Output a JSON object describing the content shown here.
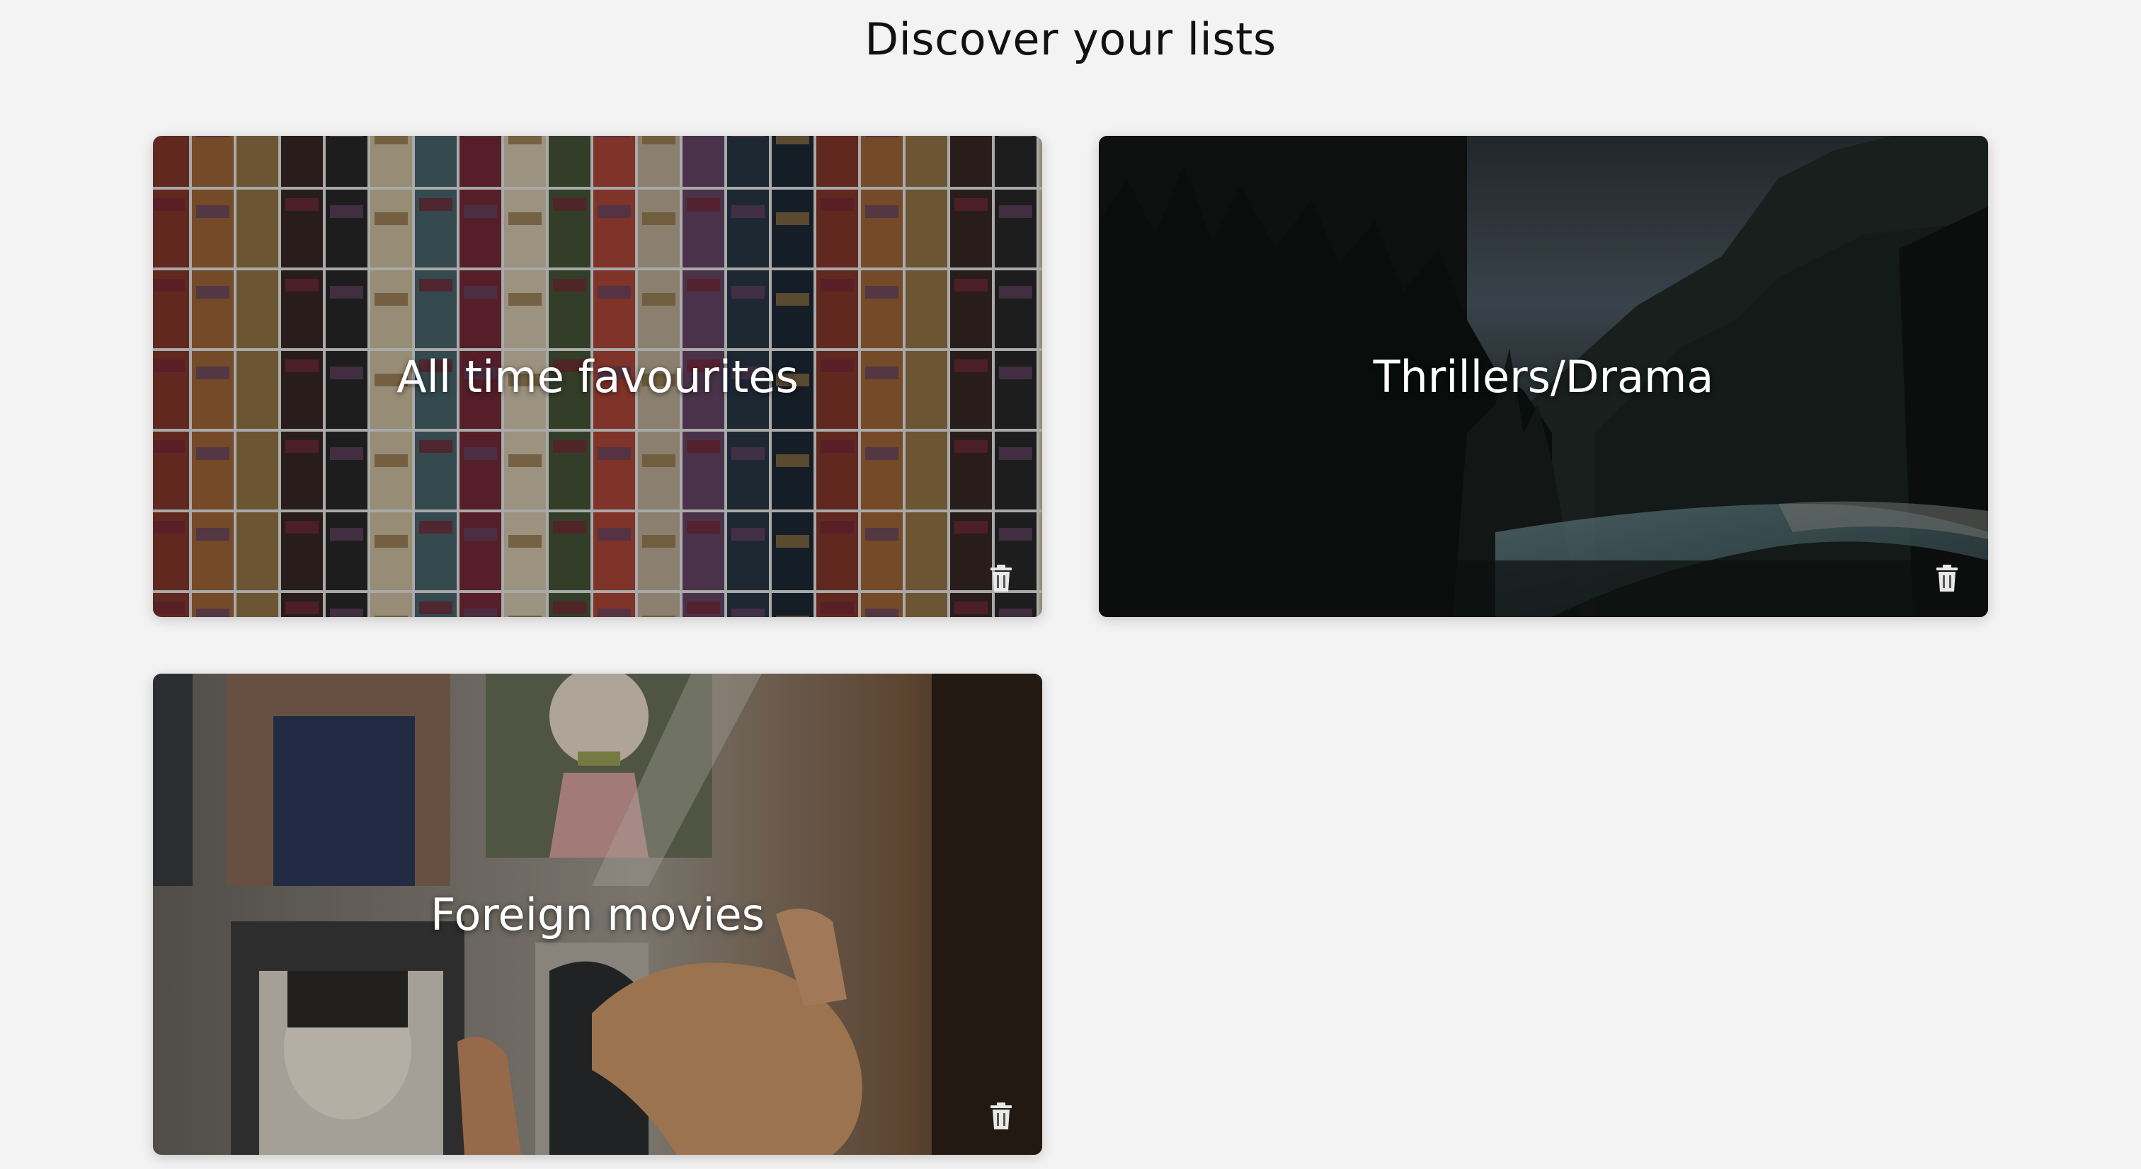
{
  "page": {
    "title": "Discover your lists"
  },
  "lists": [
    {
      "name": "All time favourites",
      "image": "vhs-tape-wall",
      "action_icon": "trash-icon"
    },
    {
      "name": "Thrillers/Drama",
      "image": "dark-mountain-forest-river",
      "action_icon": "trash-icon"
    },
    {
      "name": "Foreign movies",
      "image": "anime-photo-wall",
      "action_icon": "trash-icon"
    }
  ],
  "colors": {
    "background": "#f3f3f3",
    "title_text": "#111111",
    "card_text": "#ffffff",
    "overlay": "rgba(0,0,0,0.45)"
  }
}
